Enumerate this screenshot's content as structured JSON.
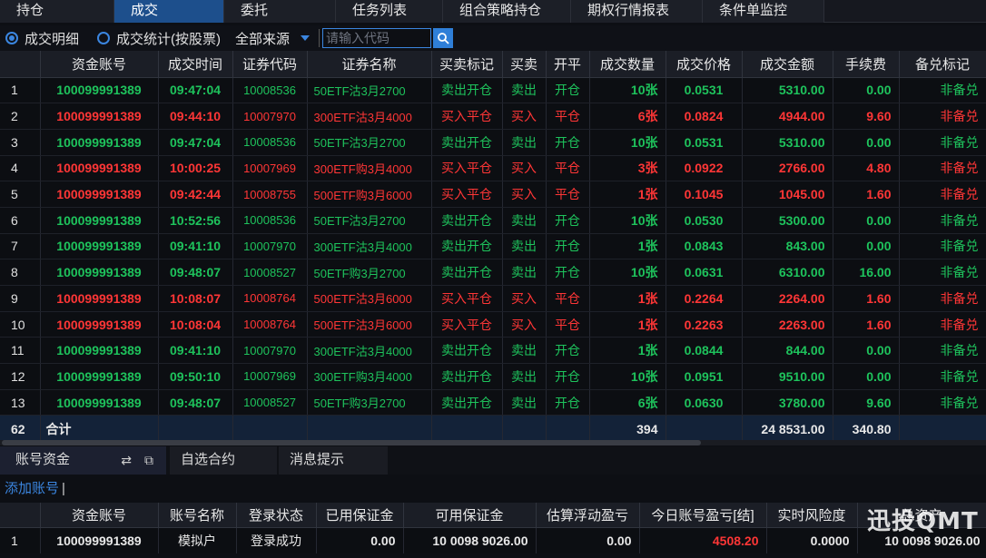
{
  "top_tabs": [
    "持仓",
    "成交",
    "委托",
    "任务列表",
    "组合策略持仓",
    "期权行情报表",
    "条件单监控"
  ],
  "active_tab": 1,
  "toolbar": {
    "radio_detail": "成交明细",
    "radio_stats": "成交统计(按股票)",
    "source": "全部来源",
    "search_placeholder": "请输入代码"
  },
  "columns": [
    "资金账号",
    "成交时间",
    "证券代码",
    "证券名称",
    "买卖标记",
    "买卖",
    "开平",
    "成交数量",
    "成交价格",
    "成交金额",
    "手续费",
    "备兑标记"
  ],
  "colors": {
    "buy": "#ff3636",
    "sell": "#1ec35c",
    "tab_active": "#1d4f8c",
    "accent": "#3b86e0"
  },
  "rows": [
    {
      "idx": "1",
      "side": "sell",
      "account": "100099991389",
      "time": "09:47:04",
      "code": "10008536",
      "name": "50ETF沽3月2700",
      "flag": "卖出开仓",
      "bs": "卖出",
      "oc": "开仓",
      "qty": "10张",
      "price": "0.0531",
      "amount": "5310.00",
      "fee": "0.00",
      "covered": "非备兑"
    },
    {
      "idx": "2",
      "side": "buy",
      "account": "100099991389",
      "time": "09:44:10",
      "code": "10007970",
      "name": "300ETF沽3月4000",
      "flag": "买入平仓",
      "bs": "买入",
      "oc": "平仓",
      "qty": "6张",
      "price": "0.0824",
      "amount": "4944.00",
      "fee": "9.60",
      "covered": "非备兑"
    },
    {
      "idx": "3",
      "side": "sell",
      "account": "100099991389",
      "time": "09:47:04",
      "code": "10008536",
      "name": "50ETF沽3月2700",
      "flag": "卖出开仓",
      "bs": "卖出",
      "oc": "开仓",
      "qty": "10张",
      "price": "0.0531",
      "amount": "5310.00",
      "fee": "0.00",
      "covered": "非备兑"
    },
    {
      "idx": "4",
      "side": "buy",
      "account": "100099991389",
      "time": "10:00:25",
      "code": "10007969",
      "name": "300ETF购3月4000",
      "flag": "买入平仓",
      "bs": "买入",
      "oc": "平仓",
      "qty": "3张",
      "price": "0.0922",
      "amount": "2766.00",
      "fee": "4.80",
      "covered": "非备兑"
    },
    {
      "idx": "5",
      "side": "buy",
      "account": "100099991389",
      "time": "09:42:44",
      "code": "10008755",
      "name": "500ETF购3月6000",
      "flag": "买入平仓",
      "bs": "买入",
      "oc": "平仓",
      "qty": "1张",
      "price": "0.1045",
      "amount": "1045.00",
      "fee": "1.60",
      "covered": "非备兑"
    },
    {
      "idx": "6",
      "side": "sell",
      "account": "100099991389",
      "time": "10:52:56",
      "code": "10008536",
      "name": "50ETF沽3月2700",
      "flag": "卖出开仓",
      "bs": "卖出",
      "oc": "开仓",
      "qty": "10张",
      "price": "0.0530",
      "amount": "5300.00",
      "fee": "0.00",
      "covered": "非备兑"
    },
    {
      "idx": "7",
      "side": "sell",
      "account": "100099991389",
      "time": "09:41:10",
      "code": "10007970",
      "name": "300ETF沽3月4000",
      "flag": "卖出开仓",
      "bs": "卖出",
      "oc": "开仓",
      "qty": "1张",
      "price": "0.0843",
      "amount": "843.00",
      "fee": "0.00",
      "covered": "非备兑"
    },
    {
      "idx": "8",
      "side": "sell",
      "account": "100099991389",
      "time": "09:48:07",
      "code": "10008527",
      "name": "50ETF购3月2700",
      "flag": "卖出开仓",
      "bs": "卖出",
      "oc": "开仓",
      "qty": "10张",
      "price": "0.0631",
      "amount": "6310.00",
      "fee": "16.00",
      "covered": "非备兑"
    },
    {
      "idx": "9",
      "side": "buy",
      "account": "100099991389",
      "time": "10:08:07",
      "code": "10008764",
      "name": "500ETF沽3月6000",
      "flag": "买入平仓",
      "bs": "买入",
      "oc": "平仓",
      "qty": "1张",
      "price": "0.2264",
      "amount": "2264.00",
      "fee": "1.60",
      "covered": "非备兑"
    },
    {
      "idx": "10",
      "side": "buy",
      "account": "100099991389",
      "time": "10:08:04",
      "code": "10008764",
      "name": "500ETF沽3月6000",
      "flag": "买入平仓",
      "bs": "买入",
      "oc": "平仓",
      "qty": "1张",
      "price": "0.2263",
      "amount": "2263.00",
      "fee": "1.60",
      "covered": "非备兑"
    },
    {
      "idx": "11",
      "side": "sell",
      "account": "100099991389",
      "time": "09:41:10",
      "code": "10007970",
      "name": "300ETF沽3月4000",
      "flag": "卖出开仓",
      "bs": "卖出",
      "oc": "开仓",
      "qty": "1张",
      "price": "0.0844",
      "amount": "844.00",
      "fee": "0.00",
      "covered": "非备兑"
    },
    {
      "idx": "12",
      "side": "sell",
      "account": "100099991389",
      "time": "09:50:10",
      "code": "10007969",
      "name": "300ETF购3月4000",
      "flag": "卖出开仓",
      "bs": "卖出",
      "oc": "开仓",
      "qty": "10张",
      "price": "0.0951",
      "amount": "9510.00",
      "fee": "0.00",
      "covered": "非备兑"
    },
    {
      "idx": "13",
      "side": "sell",
      "account": "100099991389",
      "time": "09:48:07",
      "code": "10008527",
      "name": "50ETF购3月2700",
      "flag": "卖出开仓",
      "bs": "卖出",
      "oc": "开仓",
      "qty": "6张",
      "price": "0.0630",
      "amount": "3780.00",
      "fee": "9.60",
      "covered": "非备兑"
    }
  ],
  "total": {
    "count": "62",
    "label": "合计",
    "qty": "394",
    "amount": "24 8531.00",
    "fee": "340.80"
  },
  "bottom_tabs": [
    "账号资金",
    "自选合约",
    "消息提示"
  ],
  "add_account": "添加账号",
  "account_columns": [
    "资金账号",
    "账号名称",
    "登录状态",
    "已用保证金",
    "可用保证金",
    "估算浮动盈亏",
    "今日账号盈亏[结]",
    "实时风险度",
    "总资产"
  ],
  "account_row": {
    "idx": "1",
    "account": "100099991389",
    "name": "模拟户",
    "status": "登录成功",
    "used_margin": "0.00",
    "avail_margin": "10 0098 9026.00",
    "float_pnl": "0.00",
    "today_pnl": "4508.20",
    "risk": "0.0000",
    "total": "10 0098 9026.00"
  },
  "watermark": "迅投QMT"
}
